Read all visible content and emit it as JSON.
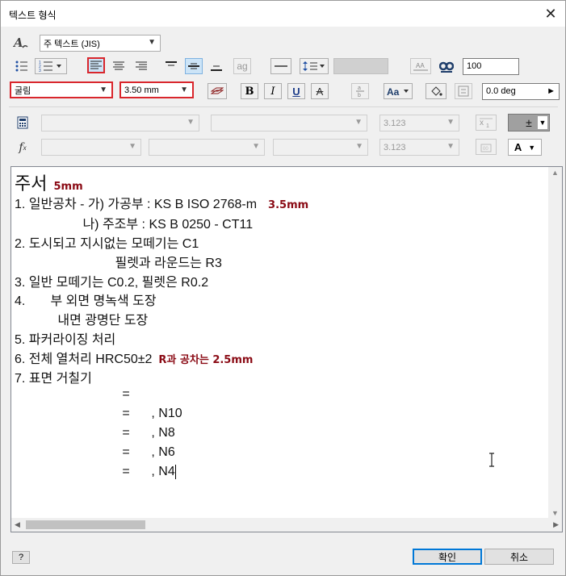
{
  "window": {
    "title": "텍스트 형식",
    "close_glyph": "✕"
  },
  "style_row": {
    "style_value": "주 텍스트 (JIS)"
  },
  "format_row": {
    "align_ag": "ag",
    "width_value": "100"
  },
  "font_row": {
    "font_value": "굴림",
    "size_value": "3.50 mm",
    "bold": "B",
    "italic": "I",
    "underline": "U",
    "strike": "A",
    "angle_value": "0.0 deg"
  },
  "param_row": {
    "precision_value": "3.123",
    "tolerance_symbol": "±"
  },
  "func_row": {
    "fx": "f",
    "fx_sub": "x",
    "precision_value": "3.123",
    "text_color_symbol": "A"
  },
  "editor": {
    "lines": [
      {
        "text": "주서",
        "annot": "5mm"
      },
      {
        "text": "1. 일반공차 - 가) 가공부 : KS B ISO 2768-m",
        "annot": "3.5mm"
      },
      {
        "text": "                   나) 주조부 : KS B 0250 - CT11",
        "annot": ""
      },
      {
        "text": "2. 도시되고 지시없는 모떼기는 C1",
        "annot": ""
      },
      {
        "text": "                            필렛과 라운드는 R3",
        "annot": ""
      },
      {
        "text": "3. 일반 모떼기는 C0.2, 필렛은 R0.2",
        "annot": ""
      },
      {
        "text": "4.       부 외면 명녹색 도장",
        "annot": ""
      },
      {
        "text": "            내면 광명단 도장",
        "annot": ""
      },
      {
        "text": "5. 파커라이징 처리",
        "annot": ""
      },
      {
        "text": "6. 전체 열처리 HRC50±2",
        "annot": "R과 공차는 2.5mm"
      },
      {
        "text": "7. 표면 거칠기",
        "annot": ""
      },
      {
        "text": "                              =",
        "annot": ""
      },
      {
        "text": "                              =      , N10",
        "annot": ""
      },
      {
        "text": "                              =      , N8",
        "annot": ""
      },
      {
        "text": "                              =      , N6",
        "annot": ""
      },
      {
        "text": "                              =      , N4",
        "annot": ""
      }
    ]
  },
  "footer": {
    "help_label": "?",
    "ok_label": "확인",
    "cancel_label": "취소"
  },
  "colors": {
    "highlight_red": "#d9262c",
    "annotation_red": "#8a0a14",
    "selected_blue": "#cce4f7"
  }
}
